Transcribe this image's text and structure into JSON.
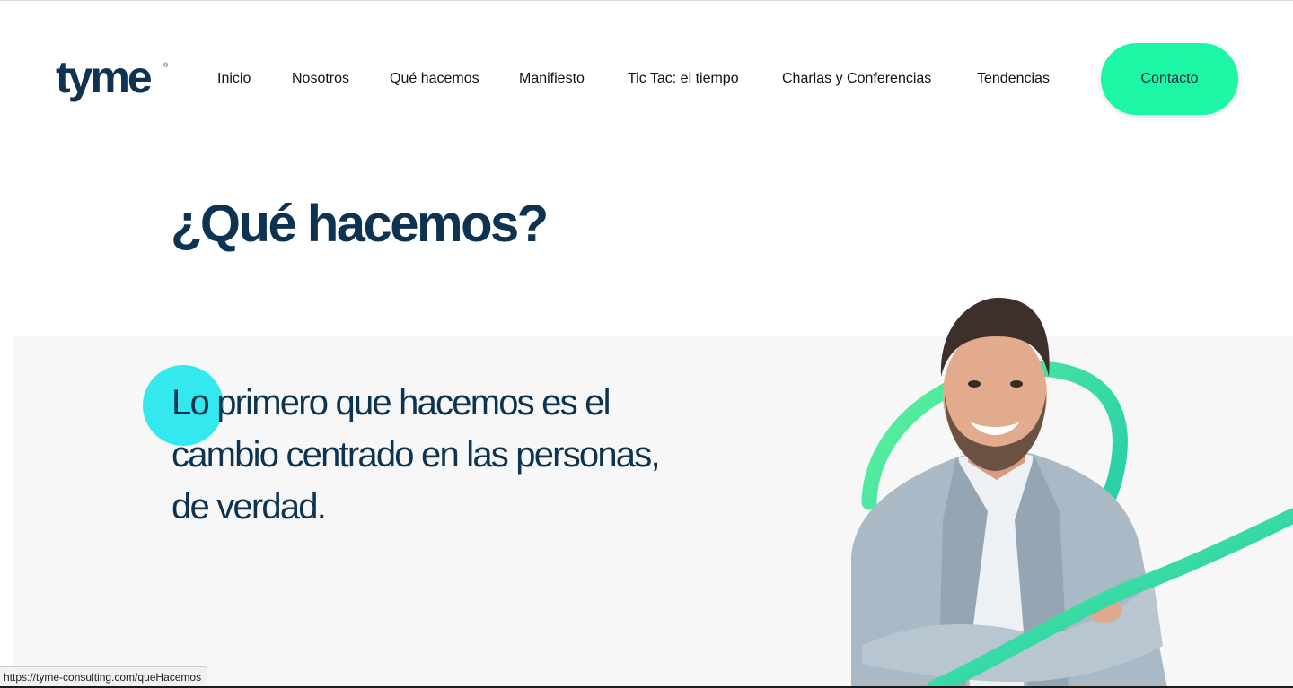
{
  "brand": {
    "logo_text": "tyme",
    "logo_mark": "®",
    "primary_color": "#0e3350",
    "accent_color": "#1cf7a5",
    "dot_color": "#33e8ee",
    "ribbon_color": "#12c8a8"
  },
  "nav": {
    "items": [
      {
        "label": "Inicio"
      },
      {
        "label": "Nosotros"
      },
      {
        "label": "Qué hacemos"
      },
      {
        "label": "Manifiesto"
      },
      {
        "label": "Tic Tac: el tiempo"
      },
      {
        "label": "Charlas y Conferencias"
      },
      {
        "label": "Tendencias"
      }
    ],
    "contact_label": "Contacto"
  },
  "hero": {
    "title": "¿Qué hacemos?",
    "statement": "Lo primero que hacemos es el cambio centrado en las personas, de verdad.",
    "image": "smiling-man-arms-crossed-photo"
  },
  "status_bar": {
    "url": "https://tyme-consulting.com/queHacemos"
  }
}
